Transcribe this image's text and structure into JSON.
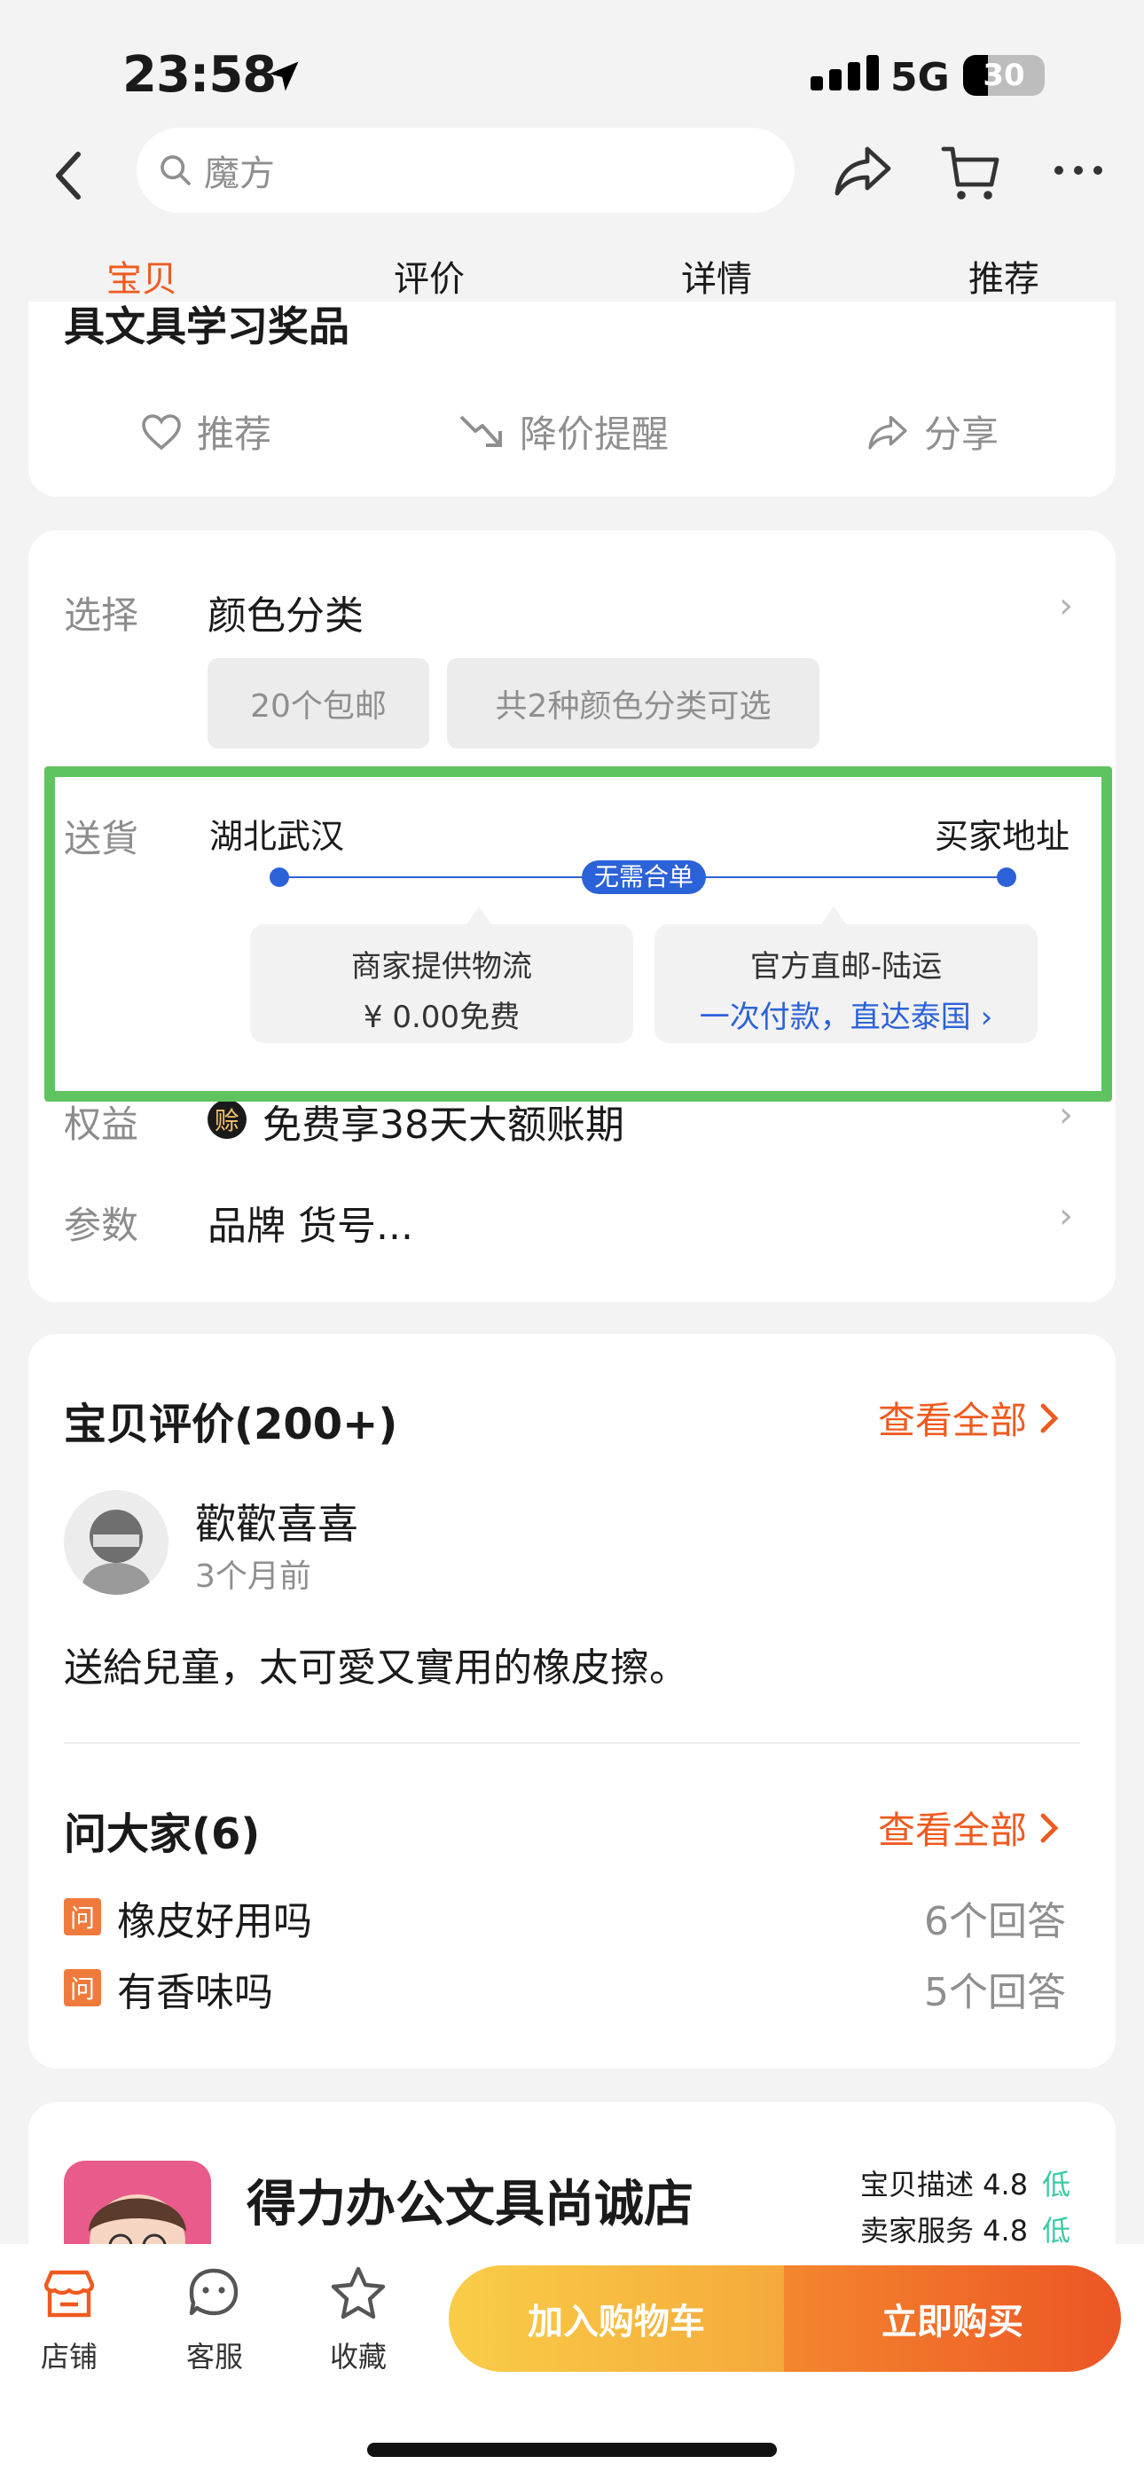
{
  "status_bar": {
    "time": "23:58",
    "network": "5G",
    "battery": "30",
    "battery_level": 0.3
  },
  "search": {
    "placeholder": "魔方"
  },
  "tabs": [
    {
      "label": "宝贝",
      "active": true
    },
    {
      "label": "评价",
      "active": false
    },
    {
      "label": "详情",
      "active": false
    },
    {
      "label": "推荐",
      "active": false
    }
  ],
  "product": {
    "title_partial": "具文具学习奖品",
    "actions": {
      "recommend": "推荐",
      "price_alert": "降价提醒",
      "share": "分享"
    }
  },
  "options": {
    "select_label": "选择",
    "select_value": "颜色分类",
    "chips": [
      "20个包邮",
      "共2种颜色分类可选"
    ],
    "shipping_label": "送貨",
    "from": "湖北武汉",
    "to": "买家地址",
    "route_badge": "无需合单",
    "box1": {
      "line1": "商家提供物流",
      "line2": "¥ 0.00免费"
    },
    "box2": {
      "line1": "官方直邮-陆运",
      "line2": "一次付款，直达泰国 ›"
    },
    "rights_label": "权益",
    "rights_badge": "赊",
    "rights_value": "免费享38天大额账期",
    "params_label": "参数",
    "params_value": "品牌 货号..."
  },
  "reviews": {
    "title": "宝贝评价(200+)",
    "view_all": "查看全部",
    "user": "歡歡喜喜",
    "time": "3个月前",
    "text": "送給兒童，太可愛又實用的橡皮擦。"
  },
  "qa": {
    "title": "问大家(6)",
    "view_all": "查看全部",
    "badge": "问",
    "items": [
      {
        "q": "橡皮好用吗",
        "a": "6个回答"
      },
      {
        "q": "有香味吗",
        "a": "5个回答"
      }
    ]
  },
  "shop": {
    "name": "得力办公文具尚诚店",
    "metrics": [
      {
        "label": "宝贝描述 4.8",
        "level": "低"
      },
      {
        "label": "卖家服务 4.8",
        "level": "低"
      }
    ]
  },
  "bottom_bar": {
    "shop": "店铺",
    "service": "客服",
    "favorite": "收藏",
    "add_cart": "加入购物车",
    "buy_now": "立即购买"
  },
  "colors": {
    "accent": "#ef5a1f",
    "highlight": "#5fc35f",
    "link": "#2c62d8",
    "rating_low": "#3cc9a5"
  }
}
